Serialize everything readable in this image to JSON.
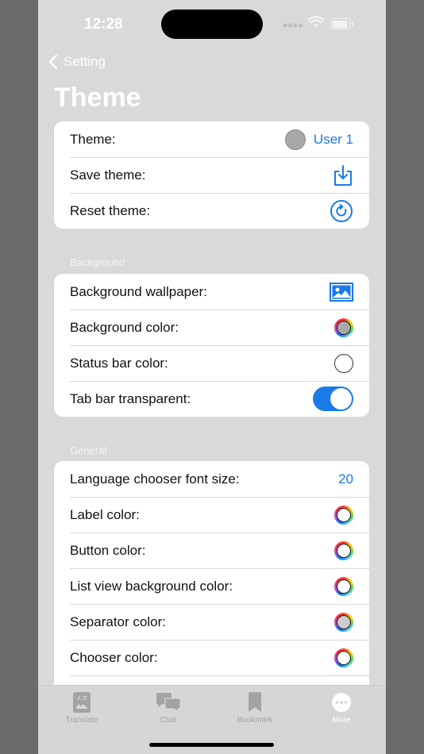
{
  "status": {
    "time": "12:28"
  },
  "nav": {
    "back_label": "Setting",
    "title": "Theme"
  },
  "theme_group": {
    "theme_label": "Theme:",
    "theme_value": "User 1",
    "save_label": "Save theme:",
    "reset_label": "Reset theme:"
  },
  "background": {
    "header": "Background",
    "wallpaper_label": "Background wallpaper:",
    "color_label": "Background color:",
    "status_bar_label": "Status bar color:",
    "tab_bar_label": "Tab bar transparent:",
    "tab_bar_transparent": true
  },
  "general": {
    "header": "General",
    "font_size_label": "Language chooser font size:",
    "font_size_value": "20",
    "label_color": "Label color:",
    "button_color": "Button color:",
    "list_bg_color": "List view background color:",
    "separator_color": "Separator color:",
    "chooser_color": "Chooser color:"
  },
  "colors": {
    "accent": "#1a7ae8",
    "swatch_grey": "#a8a8a8",
    "swatch_light": "#cccccc",
    "swatch_white": "#ffffff"
  },
  "tabs": [
    {
      "label": "Translate",
      "icon": "translate-icon"
    },
    {
      "label": "Chat",
      "icon": "chat-icon"
    },
    {
      "label": "Bookmark",
      "icon": "bookmark-icon"
    },
    {
      "label": "More",
      "icon": "more-icon"
    }
  ]
}
